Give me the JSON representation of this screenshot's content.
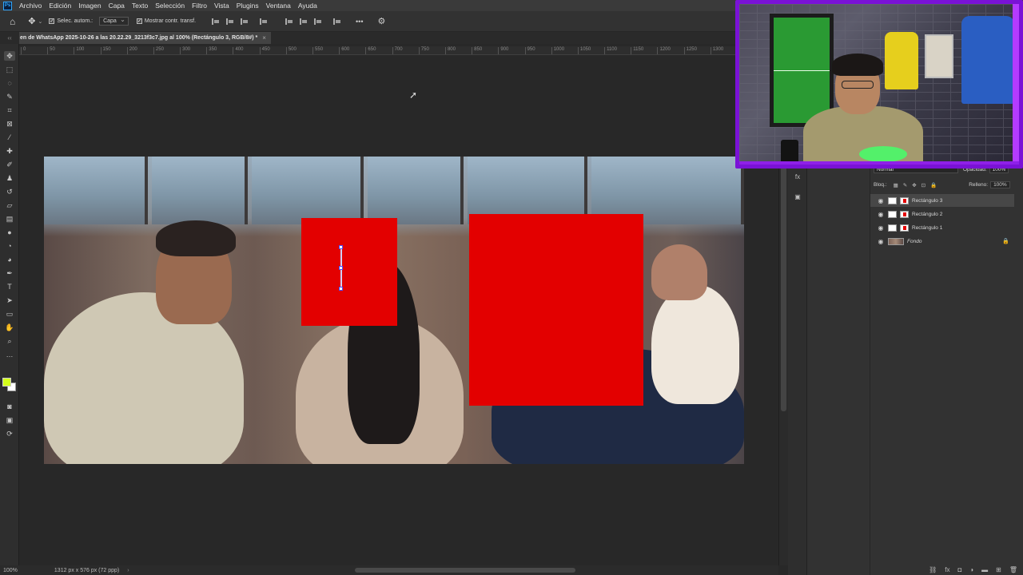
{
  "app": {
    "logo": "Ps"
  },
  "menu": [
    "Archivo",
    "Edición",
    "Imagen",
    "Capa",
    "Texto",
    "Selección",
    "Filtro",
    "Vista",
    "Plugins",
    "Ventana",
    "Ayuda"
  ],
  "options": {
    "auto_select_label": "Selec. autom.:",
    "auto_select_target": "Capa",
    "show_transform_label": "Mostrar contr. transf.",
    "more": "•••"
  },
  "document": {
    "tab_title": "en de WhatsApp 2025-10-26 a las 20.22.29_3213f3c7.jpg al 100% (Rectángulo 3, RGB/8#) *",
    "tab_close": "×"
  },
  "ruler_ticks": [
    "0",
    "50",
    "100",
    "150",
    "200",
    "250",
    "300",
    "350",
    "400",
    "450",
    "500",
    "550",
    "600",
    "650",
    "700",
    "750",
    "800",
    "850",
    "900",
    "950",
    "1000",
    "1050",
    "1100",
    "1150",
    "1200",
    "1250",
    "1300"
  ],
  "status": {
    "zoom": "100%",
    "doc_size": "1312 px x 576 px (72 ppp)",
    "arrow": "›"
  },
  "layers_panel": {
    "blend_mode": "Normal",
    "opacity_label": "Opacidad:",
    "opacity_value": "100%",
    "lock_label": "Bloq.:",
    "fill_label": "Relleno:",
    "fill_value": "100%",
    "layers": [
      {
        "name": "Rectángulo 3",
        "visible": true,
        "selected": true
      },
      {
        "name": "Rectángulo 2",
        "visible": true,
        "selected": false
      },
      {
        "name": "Rectángulo 1",
        "visible": true,
        "selected": false
      },
      {
        "name": "Fondo",
        "visible": true,
        "selected": false,
        "locked": true
      }
    ]
  },
  "colors": {
    "foreground": "#d4ff1a",
    "background": "#ffffff",
    "rect_fill": "#e30000",
    "webcam_border": "#7a12d6"
  },
  "icons": {
    "home": "home-icon",
    "move": "move-icon",
    "settings": "gear-icon",
    "eye": "eye-icon",
    "lock": "lock-icon"
  }
}
